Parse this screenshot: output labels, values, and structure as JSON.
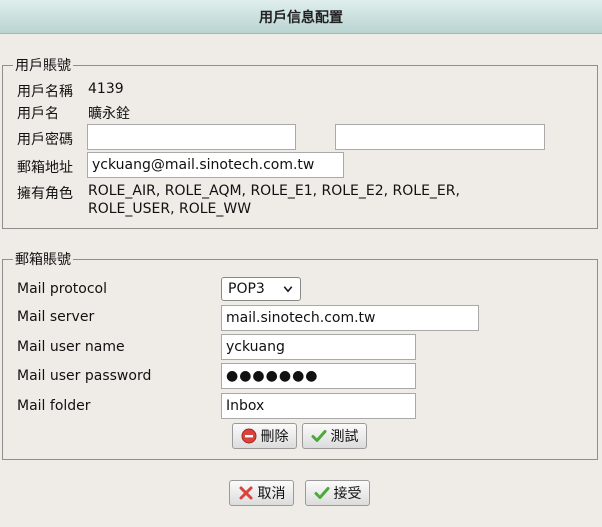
{
  "header": {
    "title": "用戶信息配置"
  },
  "account": {
    "legend": "用戶賬號",
    "username_label": "用戶名稱",
    "username_value": "4139",
    "name_label": "用戶名",
    "name_value": "曠永銓",
    "password_label": "用戶密碼",
    "password_value": "",
    "password_confirm_value": "",
    "email_label": "郵箱地址",
    "email_value": "yckuang@mail.sinotech.com.tw",
    "roles_label": "擁有角色",
    "roles_line1": "ROLE_AIR, ROLE_AQM, ROLE_E1, ROLE_E2, ROLE_ER,",
    "roles_line2": "ROLE_USER, ROLE_WW"
  },
  "mail": {
    "legend": "郵箱賬號",
    "protocol_label": "Mail protocol",
    "protocol_value": "POP3",
    "server_label": "Mail server",
    "server_value": "mail.sinotech.com.tw",
    "user_label": "Mail user name",
    "user_value": "yckuang",
    "password_label": "Mail user password",
    "password_value": "●●●●●●●",
    "folder_label": "Mail folder",
    "folder_value": "Inbox",
    "delete_label": "刪除",
    "test_label": "測試"
  },
  "footer": {
    "cancel_label": "取消",
    "accept_label": "接受"
  },
  "icons": {
    "delete": "minus-circle-icon",
    "test": "check-icon",
    "cancel": "x-icon",
    "accept": "check-icon"
  },
  "colors": {
    "titlebar": "#b9d4d2",
    "delete_icon": "#d9433b",
    "check_icon": "#4caa3b",
    "x_icon": "#d9433b"
  }
}
